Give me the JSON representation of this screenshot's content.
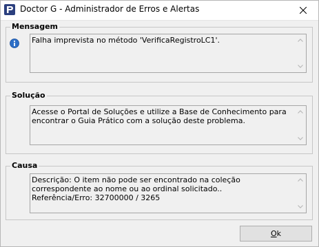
{
  "window": {
    "title": "Doctor G - Administrador de Erros e Alertas",
    "close_icon": "close-icon",
    "app_icon": "doctor-g-logo-icon"
  },
  "mensagem": {
    "label": "Mensagem",
    "icon": "info-icon",
    "text": "Falha imprevista no método 'VerificaRegistroLC1'."
  },
  "solucao": {
    "label": "Solução",
    "text": "Acesse o Portal de Soluções e utilize a Base de Conhecimento para encontrar o Guia Prático com a solução deste problema."
  },
  "causa": {
    "label": "Causa",
    "text": "Descrição: O item não pode ser encontrado na coleção correspondente ao nome ou ao ordinal solicitado..\nReferência/Erro: 32700000 / 3265"
  },
  "buttons": {
    "ok_label_mnemonic": "O",
    "ok_label_rest": "k"
  },
  "colors": {
    "title_bg": "#ffffff",
    "window_bg": "#f0f0f0",
    "app_icon_bg": "#2b3f7e",
    "info_icon_bg": "#2d6fc7"
  }
}
